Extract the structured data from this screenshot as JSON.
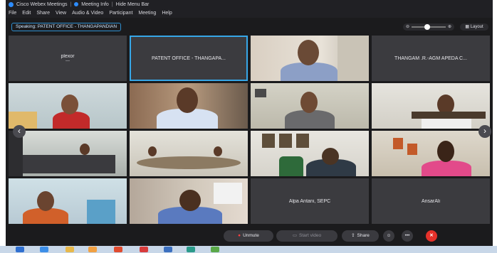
{
  "window": {
    "title_parts": [
      "Cisco Webex Meetings",
      "Meeting Info",
      "Hide Menu Bar"
    ],
    "menu": [
      "File",
      "Edit",
      "Share",
      "View",
      "Audio & Video",
      "Participant",
      "Meeting",
      "Help"
    ]
  },
  "speaker": {
    "speaking_label": "Speaking: PATENT OFFICE - THANGAPANDIAN"
  },
  "header_controls": {
    "volume_minus": "⊖",
    "volume_plus": "⊕",
    "volume_level": 0.45,
    "layout_label": "Layout"
  },
  "tiles": {
    "t1_name": "plexor",
    "t1_sub": "—",
    "t2_name": "PATENT OFFICE - THANGAPA...",
    "t4_name": "THANGAM .R.-AGM APEDA C...",
    "t19_name": "Alpa Antani, SEPC",
    "t20_name": "AnsarAli"
  },
  "nav": {
    "prev": "‹",
    "next": "›"
  },
  "controls": {
    "unmute_label": "Unmute",
    "video_label": "Start video",
    "share_label": "Share",
    "hand_icon": "☺",
    "more_icon": "•••",
    "leave_icon": "✕"
  },
  "colors": {
    "accent": "#36a7e8",
    "leave": "#e5312a",
    "background": "#1b1b1d"
  }
}
